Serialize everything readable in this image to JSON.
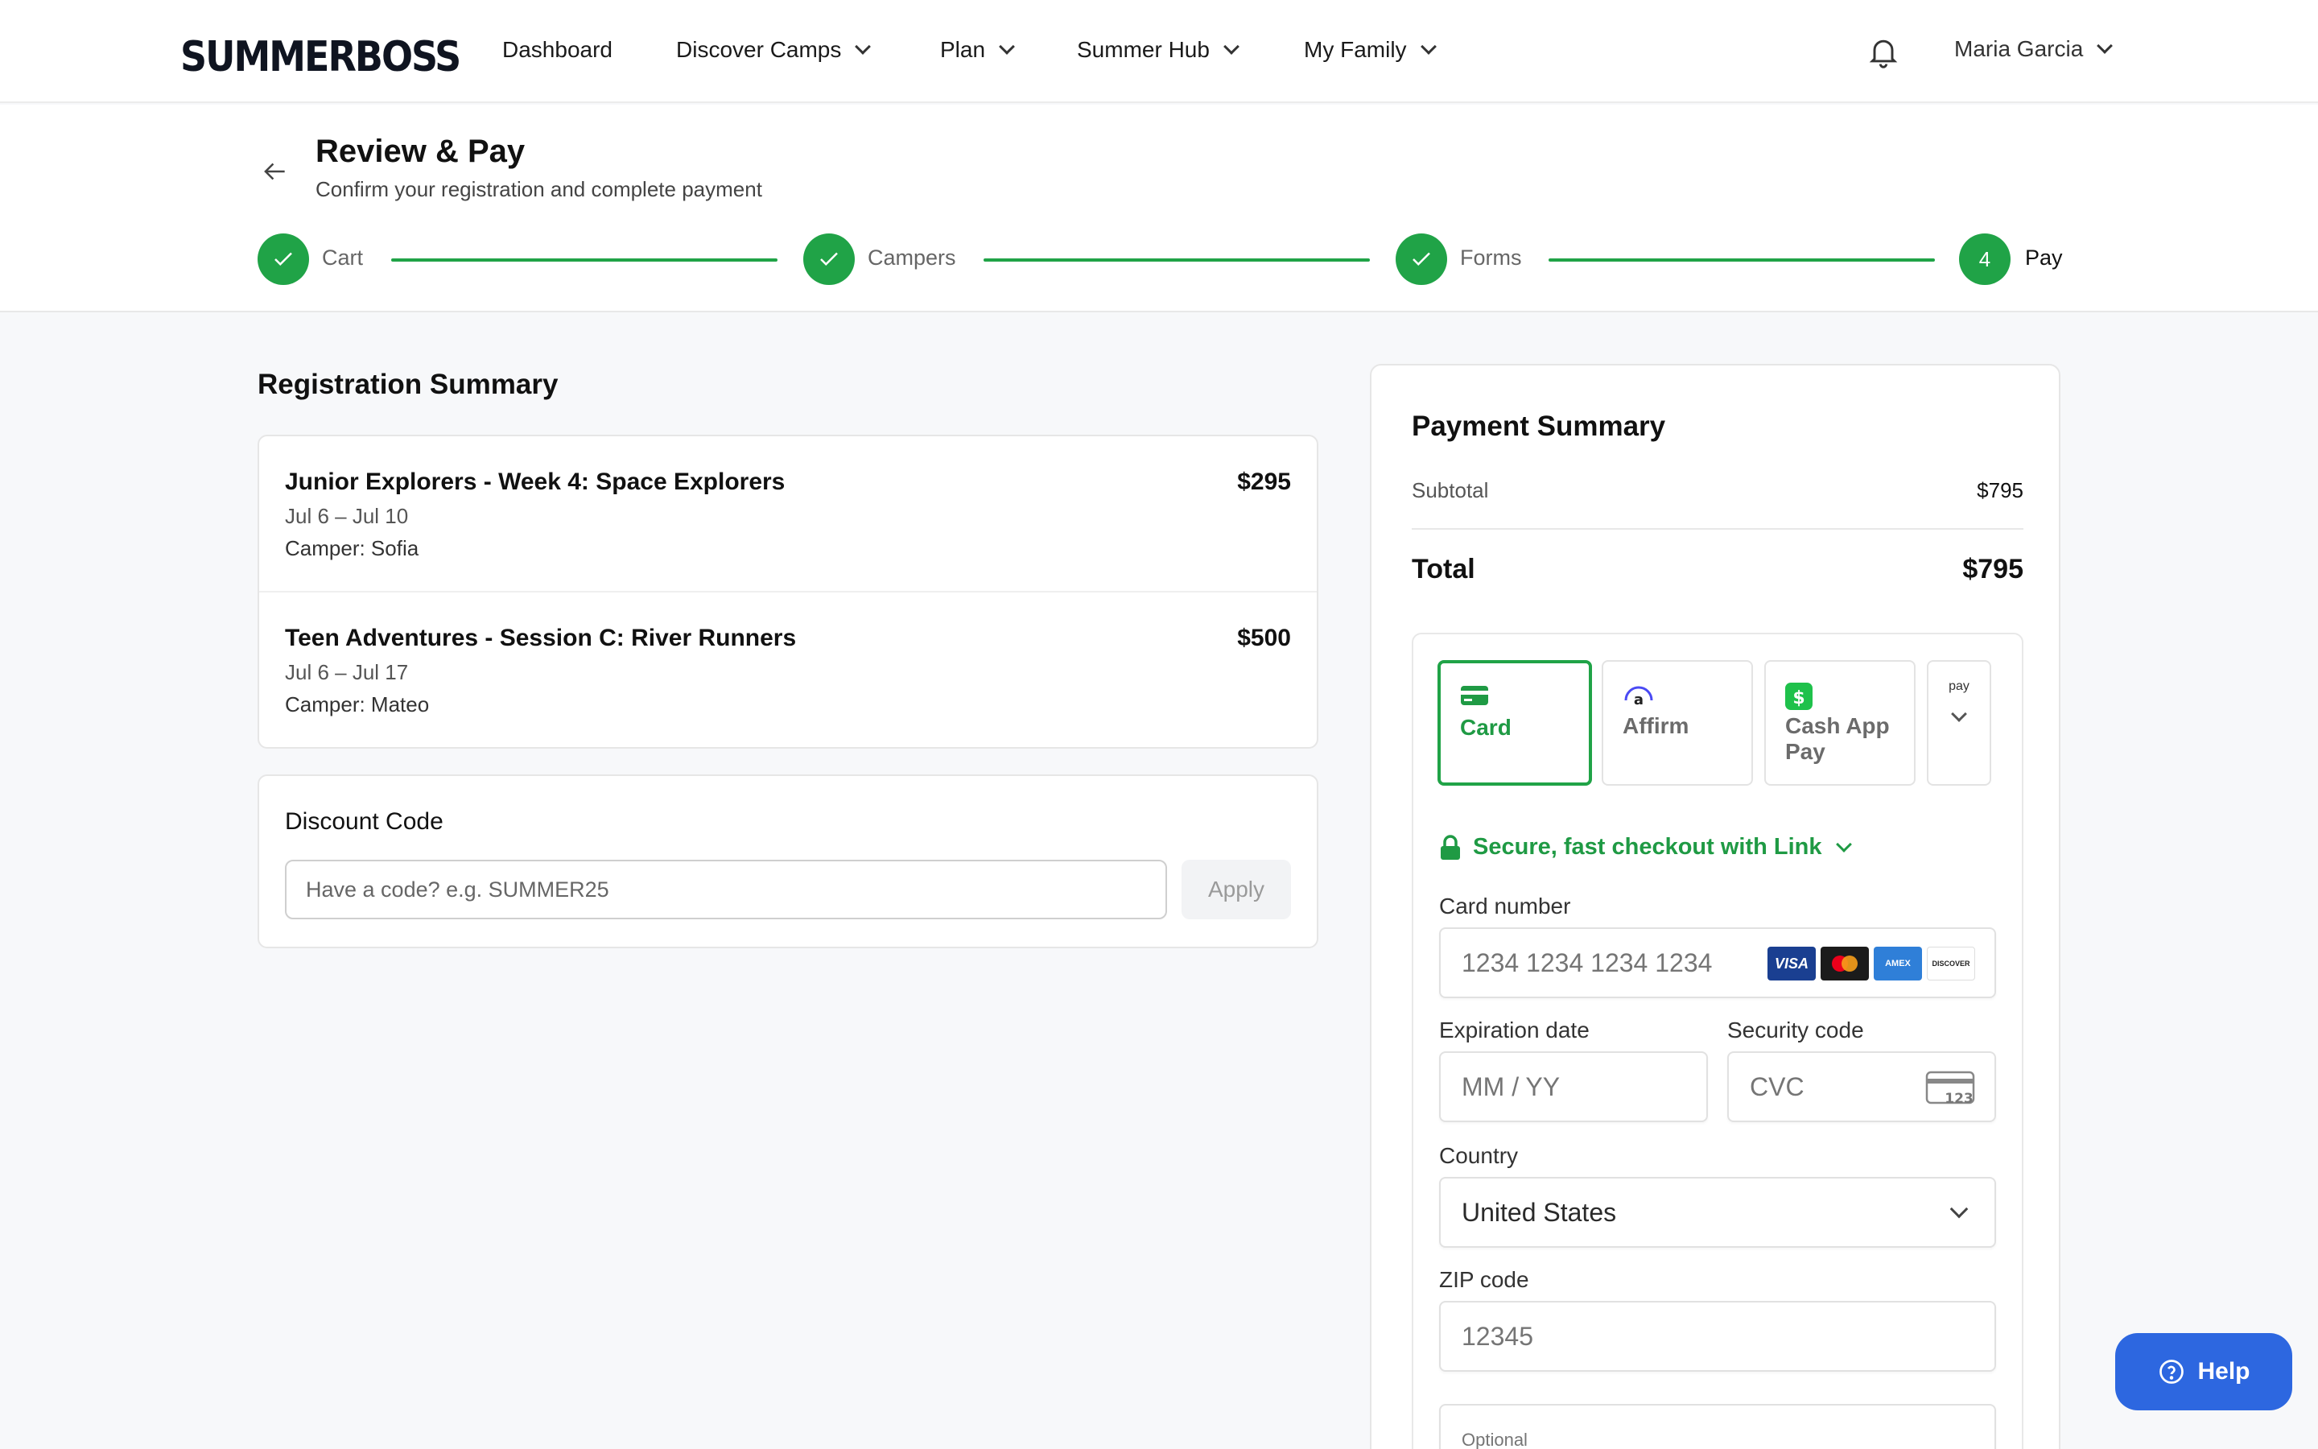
{
  "brand": {
    "logo_text": "SUMMERBOSS"
  },
  "nav": {
    "dashboard": "Dashboard",
    "discover": "Discover Camps",
    "plan": "Plan",
    "summer_hub": "Summer Hub",
    "my_family": "My Family"
  },
  "user": {
    "name": "Maria Garcia"
  },
  "page": {
    "title": "Review & Pay",
    "subtitle": "Confirm your registration and complete payment"
  },
  "steps": [
    {
      "label": "Cart",
      "state": "done"
    },
    {
      "label": "Campers",
      "state": "done"
    },
    {
      "label": "Forms",
      "state": "done"
    },
    {
      "label": "Pay",
      "number": "4",
      "state": "current"
    }
  ],
  "registration": {
    "title": "Registration Summary",
    "items": [
      {
        "name": "Junior Explorers - Week 4: Space Explorers",
        "dates": "Jul 6 – Jul 10",
        "camper": "Camper: Sofia",
        "price": "$295"
      },
      {
        "name": "Teen Adventures - Session C: River Runners",
        "dates": "Jul 6 – Jul 17",
        "camper": "Camper: Mateo",
        "price": "$500"
      }
    ]
  },
  "discount": {
    "title": "Discount Code",
    "placeholder": "Have a code? e.g. SUMMER25",
    "apply_label": "Apply"
  },
  "payment": {
    "title": "Payment Summary",
    "subtotal_label": "Subtotal",
    "subtotal_value": "$795",
    "total_label": "Total",
    "total_value": "$795",
    "methods": [
      {
        "label": "Card",
        "selected": true
      },
      {
        "label": "Affirm",
        "selected": false
      },
      {
        "label": "Cash App Pay",
        "selected": false
      }
    ],
    "more_method_badge": "pay",
    "link_text": "Secure, fast checkout with Link",
    "card_number_label": "Card number",
    "card_number_placeholder": "1234 1234 1234 1234",
    "card_brands": [
      "VISA",
      "Mastercard",
      "AMEX",
      "DISCOVER"
    ],
    "expiry_label": "Expiration date",
    "expiry_placeholder": "MM / YY",
    "cvc_label": "Security code",
    "cvc_placeholder": "CVC",
    "cvc_icon_text": "123",
    "country_label": "Country",
    "country_value": "United States",
    "zip_label": "ZIP code",
    "zip_placeholder": "12345",
    "optional_label": "Optional"
  },
  "help": {
    "label": "Help"
  },
  "colors": {
    "accent_green": "#20a347",
    "help_blue": "#2d67e0"
  }
}
